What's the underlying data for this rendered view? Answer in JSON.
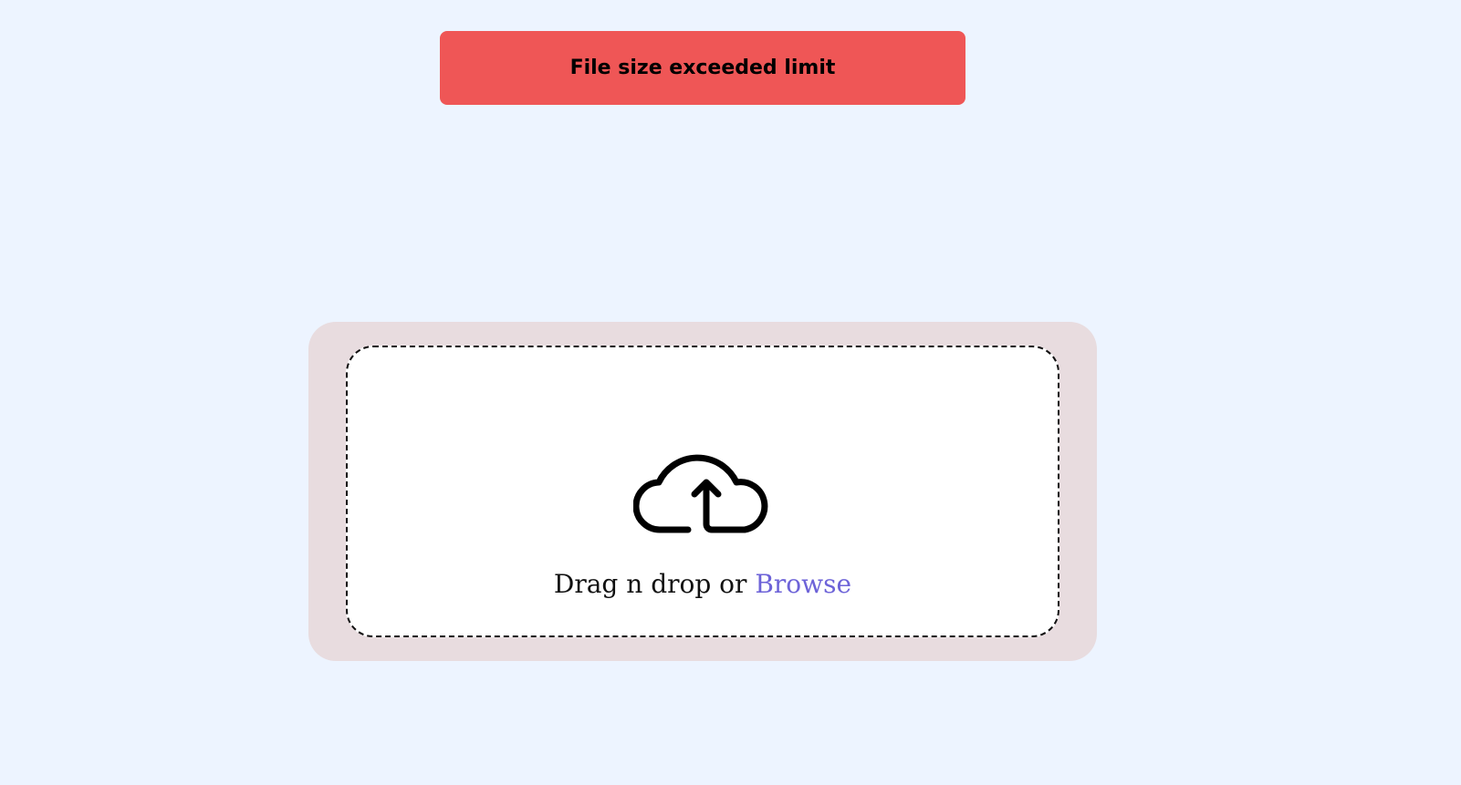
{
  "notification": {
    "message": "File size exceeded limit",
    "color": "#ef5656"
  },
  "uploader": {
    "icon": "cloud-upload-icon",
    "prompt_text": "Drag n drop or",
    "browse_label": "Browse",
    "link_color": "#6d63d8"
  }
}
